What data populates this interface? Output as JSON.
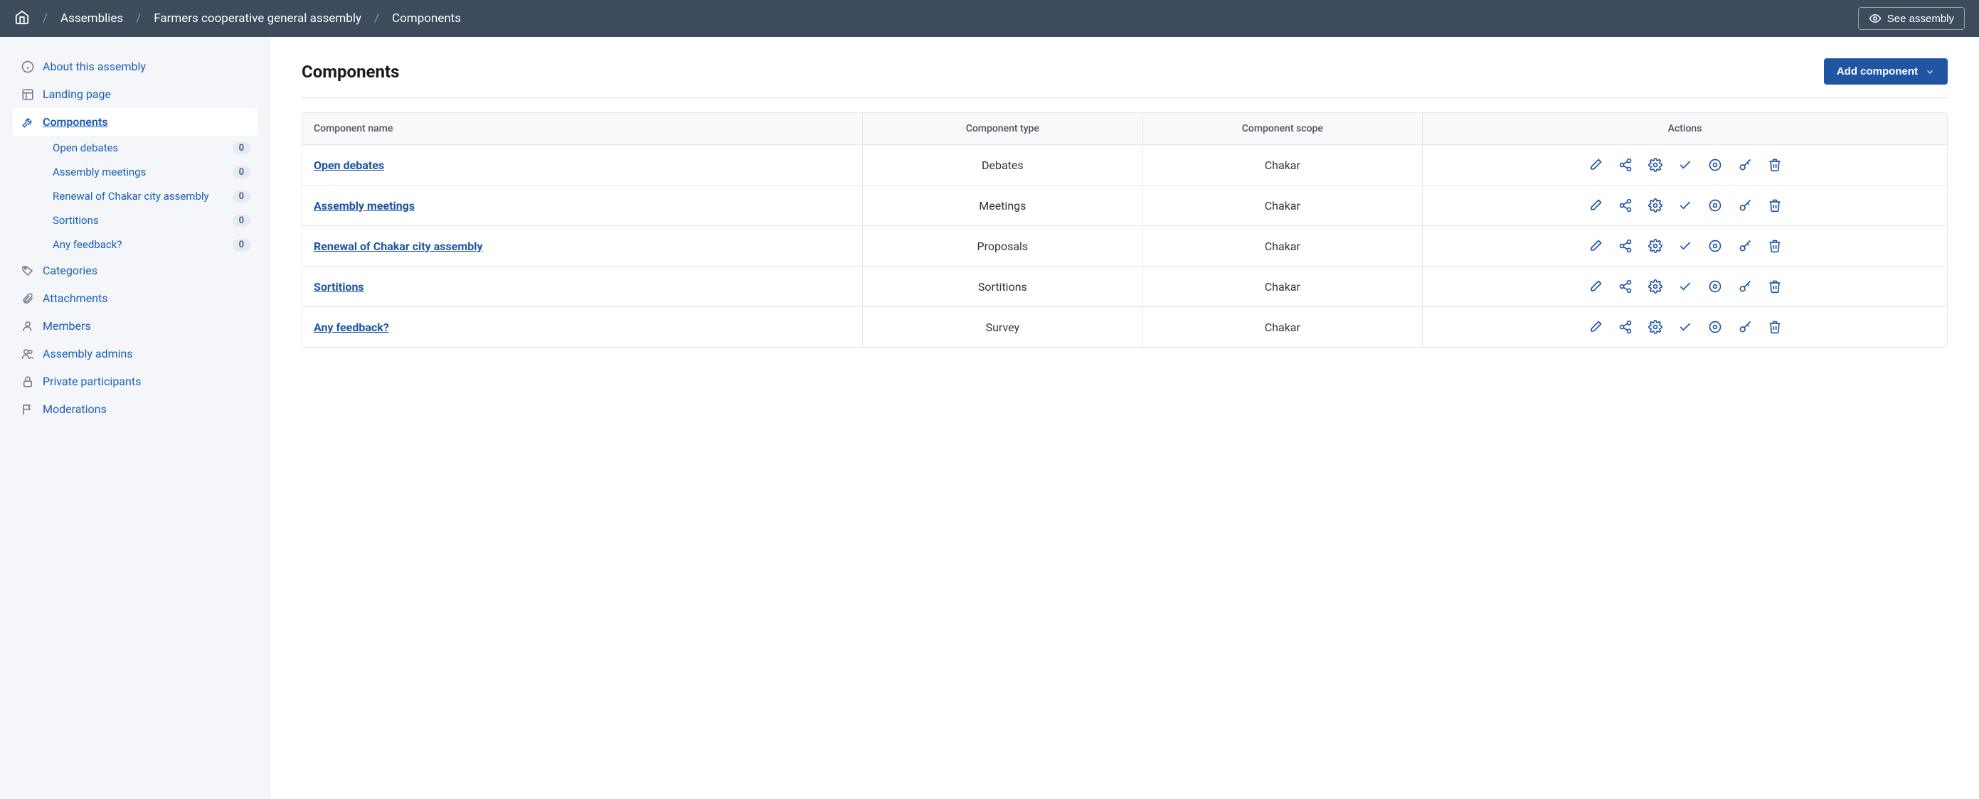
{
  "topbar": {
    "breadcrumb": [
      "Assemblies",
      "Farmers cooperative general assembly",
      "Components"
    ],
    "see_assembly": "See assembly"
  },
  "sidebar": {
    "items": [
      {
        "label": "About this assembly",
        "icon": "info"
      },
      {
        "label": "Landing page",
        "icon": "layout"
      },
      {
        "label": "Components",
        "icon": "tools",
        "active": true
      },
      {
        "label": "Categories",
        "icon": "tag"
      },
      {
        "label": "Attachments",
        "icon": "paperclip"
      },
      {
        "label": "Members",
        "icon": "user"
      },
      {
        "label": "Assembly admins",
        "icon": "users"
      },
      {
        "label": "Private participants",
        "icon": "lock"
      },
      {
        "label": "Moderations",
        "icon": "flag"
      }
    ],
    "sub_components": [
      {
        "label": "Open debates",
        "count": "0"
      },
      {
        "label": "Assembly meetings",
        "count": "0"
      },
      {
        "label": "Renewal of Chakar city assembly",
        "count": "0"
      },
      {
        "label": "Sortitions",
        "count": "0"
      },
      {
        "label": "Any feedback?",
        "count": "0"
      }
    ]
  },
  "main": {
    "title": "Components",
    "add_button": "Add component",
    "headers": {
      "name": "Component name",
      "type": "Component type",
      "scope": "Component scope",
      "actions": "Actions"
    },
    "rows": [
      {
        "name": "Open debates",
        "type": "Debates",
        "scope": "Chakar"
      },
      {
        "name": "Assembly meetings",
        "type": "Meetings",
        "scope": "Chakar"
      },
      {
        "name": "Renewal of Chakar city assembly",
        "type": "Proposals",
        "scope": "Chakar"
      },
      {
        "name": "Sortitions",
        "type": "Sortitions",
        "scope": "Chakar"
      },
      {
        "name": "Any feedback?",
        "type": "Survey",
        "scope": "Chakar"
      }
    ]
  }
}
